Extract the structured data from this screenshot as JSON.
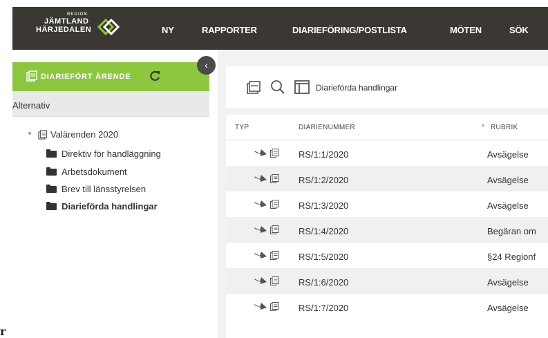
{
  "header": {
    "logo": {
      "region": "REGION",
      "line1": "JÄMTLAND",
      "line2": "HÄRJEDALEN"
    },
    "nav": [
      "NY",
      "RAPPORTER",
      "DIARIEFÖRING/POSTLISTA",
      "MÖTEN",
      "SÖK"
    ]
  },
  "sidebar": {
    "collapse_icon": "chevron-left-icon",
    "case_header": "DIARIEFÖRT ÄRENDE",
    "alternatives_label": "Alternativ",
    "tree": {
      "root": "Valärenden 2020",
      "items": [
        {
          "label": "Direktiv för handläggning",
          "active": false
        },
        {
          "label": "Arbetsdokument",
          "active": false
        },
        {
          "label": "Brev till länsstyrelsen",
          "active": false
        },
        {
          "label": "Diarieförda handlingar",
          "active": true
        }
      ]
    }
  },
  "toolbar": {
    "icons": [
      "archive-icon",
      "search-icon",
      "layout-icon"
    ],
    "title": "Diarieförda handlingar"
  },
  "table": {
    "columns": [
      "TYP",
      "DIARIENUMMER",
      "RUBRIK"
    ],
    "rows": [
      {
        "number": "RS/1:1/2020",
        "rubrik": "Avsägelse"
      },
      {
        "number": "RS/1:2/2020",
        "rubrik": "Avsägelse"
      },
      {
        "number": "RS/1:3/2020",
        "rubrik": "Avsägelse"
      },
      {
        "number": "RS/1:4/2020",
        "rubrik": "Begäran om"
      },
      {
        "number": "RS/1:5/2020",
        "rubrik": "§24 Regionf"
      },
      {
        "number": "RS/1:6/2020",
        "rubrik": "Avsägelse"
      },
      {
        "number": "RS/1:7/2020",
        "rubrik": "Avsägelse"
      }
    ]
  },
  "edge_text": "r",
  "colors": {
    "topbar": "#3b3833",
    "accent": "#8dc63f"
  }
}
